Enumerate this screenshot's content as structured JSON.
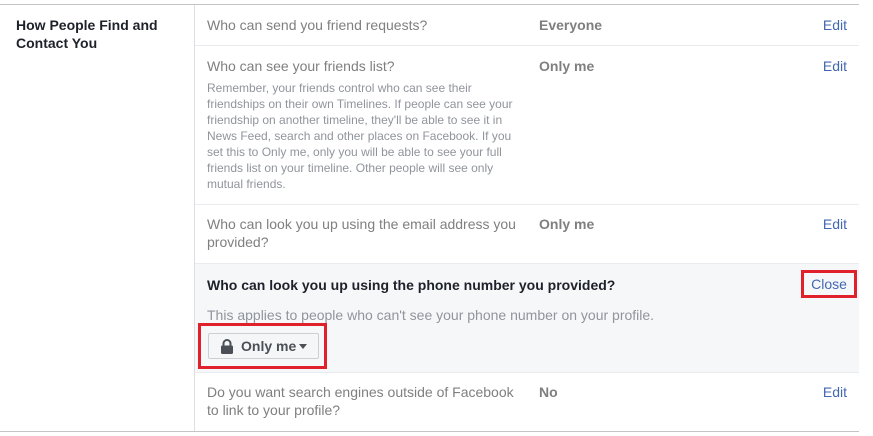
{
  "section": {
    "title": "How People Find and Contact You"
  },
  "rows": [
    {
      "question": "Who can send you friend requests?",
      "value": "Everyone",
      "action": "Edit"
    },
    {
      "question": "Who can see your friends list?",
      "value": "Only me",
      "action": "Edit",
      "description": "Remember, your friends control who can see their friendships on their own Timelines. If people can see your friendship on another timeline, they'll be able to see it in News Feed, search and other places on Facebook. If you set this to Only me, only you will be able to see your full friends list on your timeline. Other people will see only mutual friends."
    },
    {
      "question": "Who can look you up using the email address you provided?",
      "value": "Only me",
      "action": "Edit"
    },
    {
      "question": "Do you want search engines outside of Facebook to link to your profile?",
      "value": "No",
      "action": "Edit"
    }
  ],
  "expanded": {
    "question": "Who can look you up using the phone number you provided?",
    "note": "This applies to people who can't see your phone number on your profile.",
    "close_label": "Close",
    "dropdown": {
      "selected": "Only me",
      "icon": "lock-icon"
    }
  },
  "colors": {
    "link": "#4267b2",
    "highlight": "#e0202b",
    "expanded_bg": "#f6f7f9"
  }
}
